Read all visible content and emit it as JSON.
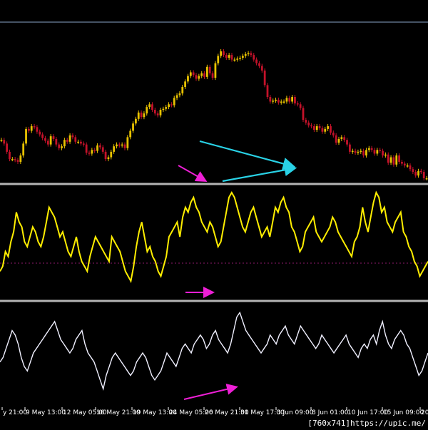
{
  "watermark": "[760x741]https://upic.me/",
  "colors": {
    "background": "#000000",
    "separator": "#b4b4b4",
    "top_line": "#8aa3c8",
    "bull_candle": "#e8c200",
    "bear_candle": "#c4122a",
    "rsi_line": "#ffee00",
    "osc_line": "#f0f0ff",
    "level_line": "#8b1a6b",
    "annotation_cyan": "#29d2e6",
    "annotation_magenta": "#ee1fd6"
  },
  "chart_data": [
    {
      "type": "candlestick",
      "panel": "price",
      "grid": false,
      "series": [
        {
          "values": [
            141,
            137,
            128,
            120,
            120,
            119,
            117,
            124,
            137,
            153,
            151,
            156,
            155,
            150,
            147,
            143,
            140,
            136,
            145,
            142,
            136,
            132,
            134,
            141,
            139,
            146,
            144,
            139,
            139,
            137,
            136,
            127,
            126,
            130,
            129,
            135,
            133,
            128,
            120,
            122,
            128,
            134,
            136,
            135,
            136,
            132,
            144,
            151,
            159,
            164,
            171,
            166,
            170,
            177,
            180,
            174,
            170,
            168,
            174,
            175,
            177,
            180,
            179,
            187,
            190,
            192,
            199,
            205,
            211,
            215,
            212,
            208,
            211,
            214,
            210,
            221,
            214,
            209,
            225,
            233,
            238,
            234,
            231,
            234,
            229,
            229,
            230,
            231,
            233,
            235,
            236,
            234,
            229,
            225,
            222,
            217,
            201,
            188,
            183,
            184,
            185,
            182,
            183,
            183,
            187,
            183,
            188,
            181,
            180,
            176,
            163,
            160,
            157,
            156,
            152,
            156,
            154,
            150,
            153,
            156,
            149,
            146,
            138,
            142,
            144,
            141,
            136,
            128,
            129,
            127,
            128,
            129,
            124,
            130,
            132,
            130,
            126,
            130,
            129,
            124,
            125,
            116,
            122,
            114,
            124,
            117,
            115,
            113,
            113,
            109,
            106,
            102,
            107,
            106,
            99,
            99
          ]
        }
      ],
      "annotations": [
        {
          "type": "triangle",
          "color": "cyan"
        },
        {
          "type": "arrow",
          "color": "magenta"
        }
      ]
    },
    {
      "type": "line",
      "panel": "oscillator-1",
      "grid": false,
      "reference_level": 50,
      "series": [
        {
          "values": [
            20,
            25,
            40,
            35,
            50,
            60,
            80,
            70,
            65,
            50,
            45,
            55,
            65,
            60,
            50,
            45,
            55,
            70,
            85,
            80,
            75,
            65,
            55,
            60,
            50,
            40,
            35,
            45,
            55,
            40,
            30,
            25,
            20,
            35,
            45,
            55,
            50,
            45,
            40,
            35,
            30,
            55,
            50,
            45,
            40,
            30,
            20,
            15,
            10,
            25,
            45,
            60,
            70,
            55,
            40,
            45,
            35,
            30,
            20,
            15,
            25,
            35,
            55,
            60,
            65,
            70,
            55,
            75,
            85,
            80,
            90,
            95,
            85,
            80,
            70,
            65,
            60,
            70,
            65,
            55,
            45,
            50,
            65,
            80,
            95,
            100,
            95,
            85,
            75,
            65,
            60,
            70,
            80,
            85,
            75,
            65,
            55,
            60,
            65,
            55,
            70,
            85,
            80,
            90,
            95,
            85,
            80,
            65,
            60,
            50,
            40,
            45,
            60,
            65,
            70,
            75,
            60,
            55,
            50,
            55,
            60,
            65,
            75,
            70,
            60,
            55,
            50,
            45,
            40,
            35,
            50,
            55,
            65,
            85,
            70,
            60,
            75,
            90,
            100,
            95,
            80,
            85,
            70,
            65,
            60,
            70,
            75,
            80,
            60,
            55,
            45,
            40,
            30,
            25,
            15,
            20,
            25,
            30
          ]
        }
      ],
      "annotations": [
        {
          "type": "arrow",
          "color": "magenta"
        }
      ]
    },
    {
      "type": "line",
      "panel": "oscillator-2",
      "grid": false,
      "series": [
        {
          "values": [
            40,
            45,
            55,
            65,
            75,
            70,
            60,
            45,
            35,
            30,
            40,
            50,
            55,
            60,
            65,
            70,
            75,
            80,
            85,
            75,
            65,
            60,
            55,
            50,
            55,
            65,
            70,
            75,
            60,
            50,
            45,
            40,
            30,
            20,
            10,
            25,
            35,
            45,
            50,
            45,
            40,
            35,
            30,
            25,
            30,
            40,
            45,
            50,
            45,
            35,
            25,
            20,
            25,
            30,
            40,
            50,
            45,
            40,
            35,
            45,
            55,
            60,
            55,
            50,
            60,
            65,
            70,
            65,
            55,
            60,
            70,
            75,
            65,
            60,
            55,
            50,
            60,
            75,
            90,
            95,
            85,
            75,
            70,
            65,
            60,
            55,
            50,
            55,
            60,
            70,
            65,
            60,
            70,
            75,
            80,
            70,
            65,
            60,
            70,
            80,
            75,
            70,
            65,
            60,
            55,
            60,
            70,
            65,
            60,
            55,
            50,
            55,
            60,
            65,
            70,
            60,
            55,
            50,
            45,
            55,
            60,
            55,
            65,
            70,
            60,
            75,
            85,
            70,
            60,
            55,
            65,
            70,
            75,
            70,
            60,
            55,
            45,
            35,
            25,
            30,
            40,
            50
          ]
        }
      ],
      "annotations": [
        {
          "type": "arrow",
          "color": "magenta"
        }
      ]
    }
  ],
  "x_ticks": [
    "y 21:00",
    "9 May 13:00",
    "12 May 05:00",
    "16 May 21:00",
    "19 May 13:00",
    "24 May 05:00",
    "26 May 21:00",
    "31 May 17:00",
    "3 Jun 09:00",
    "8 Jun 01:00",
    "10 Jun 17:00",
    "15 Jun 09:00",
    "20"
  ]
}
